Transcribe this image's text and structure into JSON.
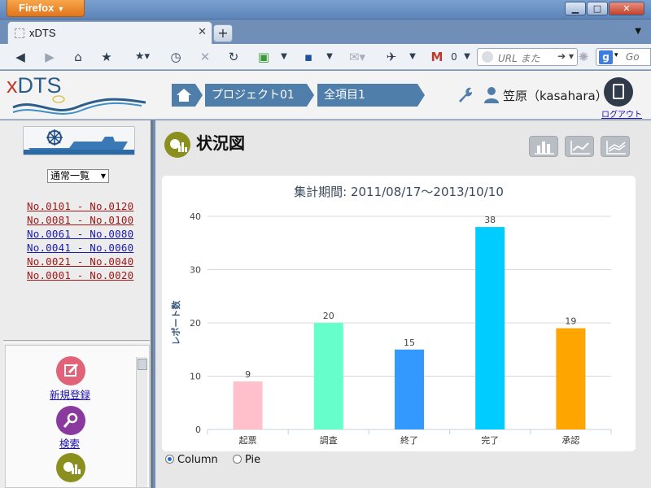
{
  "browser": {
    "app_button": "Firefox",
    "tab_title": "xDTS",
    "url_placeholder": "URL また",
    "gmail_count": "0",
    "search_placeholder": "Go"
  },
  "header": {
    "logo_x": "x",
    "logo_dts": "DTS",
    "breadcrumbs": [
      "プロジェクト01",
      "全項目1"
    ],
    "user_name": "笠原（kasahara）",
    "logout_label": "ログアウト"
  },
  "sidebar": {
    "view_select": "通常一覧",
    "ranges": [
      {
        "label": "No.0101 - No.0120",
        "color": "#a01818"
      },
      {
        "label": "No.0081 - No.0100",
        "color": "#a01818"
      },
      {
        "label": "No.0061 - No.0080",
        "color": "#1a1ab0"
      },
      {
        "label": "No.0041 - No.0060",
        "color": "#1a1ab0"
      },
      {
        "label": "No.0021 - No.0040",
        "color": "#a01818"
      },
      {
        "label": "No.0001 - No.0020",
        "color": "#a01818"
      }
    ],
    "menu": {
      "new": "新規登録",
      "search": "検索"
    }
  },
  "main": {
    "title": "状況図",
    "chart_type_options": [
      "Column",
      "Pie"
    ],
    "selected_chart_type": "Column"
  },
  "chart_data": {
    "type": "bar",
    "title": "集計期間: 2011/08/17～2013/10/10",
    "xlabel": "",
    "ylabel": "レポート数",
    "categories": [
      "起票",
      "調査",
      "終了",
      "完了",
      "承認"
    ],
    "values": [
      9,
      20,
      15,
      38,
      19
    ],
    "colors": [
      "#ffc0cb",
      "#66ffcc",
      "#3399ff",
      "#00ccff",
      "#ffa500"
    ],
    "ylim": [
      0,
      40
    ],
    "yticks": [
      0,
      10,
      20,
      30,
      40
    ],
    "grid": true,
    "data_labels": true
  }
}
